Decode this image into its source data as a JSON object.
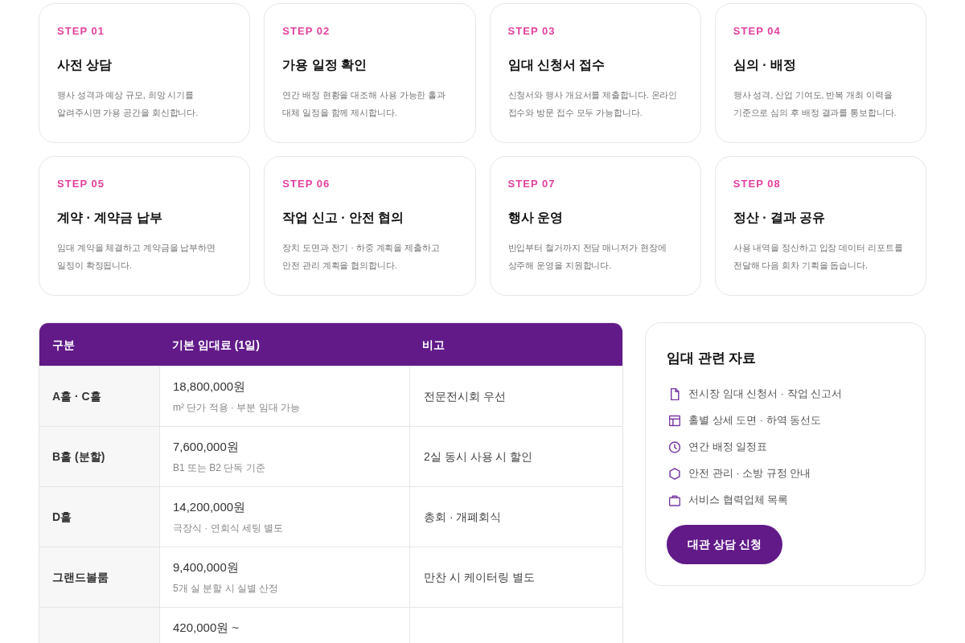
{
  "steps": [
    {
      "label": "STEP 01",
      "title": "사전 상담",
      "description": "행사 성격과 예상 규모, 희망 시기를\n알려주시면 가용 공간을 회신합니다."
    },
    {
      "label": "STEP 02",
      "title": "가용 일정 확인",
      "description": "연간 배정 현황을 대조해 사용 가능한 홀과\n대체 일정을 함께 제시합니다."
    },
    {
      "label": "STEP 03",
      "title": "임대 신청서 접수",
      "description": "신청서와 행사 개요서를 제출합니다. 온라인\n접수와 방문 접수 모두 가능합니다."
    },
    {
      "label": "STEP 04",
      "title": "심의 · 배정",
      "description": "행사 성격, 산업 기여도, 반복 개최 이력을\n기준으로 심의 후 배정 결과를 통보합니다."
    },
    {
      "label": "STEP 05",
      "title": "계약 · 계약금 납부",
      "description": "임대 계약을 체결하고 계약금을 납부하면\n일정이 확정됩니다."
    },
    {
      "label": "STEP 06",
      "title": "작업 신고 · 안전 협의",
      "description": "장치 도면과 전기 · 하중 계획을 제출하고\n안전 관리 계획을 협의합니다."
    },
    {
      "label": "STEP 07",
      "title": "행사 운영",
      "description": "반입부터 철거까지 전담 매니저가 현장에\n상주해 운영을 지원합니다."
    },
    {
      "label": "STEP 08",
      "title": "정산 · 결과 공유",
      "description": "사용 내역을 정산하고 입장 데이터 리포트를\n전달해 다음 회차 기획을 돕습니다."
    }
  ],
  "rate_table": {
    "columns": [
      "구분",
      "기본 임대료 (1일)",
      "비고"
    ],
    "rows": [
      {
        "hall": "A홀 · C홀",
        "price": "18,800,000원",
        "price_note": "m² 단가 적용 · 부분 임대 가능",
        "remark": "전문전시회 우선"
      },
      {
        "hall": "B홀 (분할)",
        "price": "7,600,000원",
        "price_note": "B1 또는 B2 단독 기준",
        "remark": "2실 동시 사용 시 할인"
      },
      {
        "hall": "D홀",
        "price": "14,200,000원",
        "price_note": "극장식 · 연회식 세팅 별도",
        "remark": "총회 · 개폐회식"
      },
      {
        "hall": "그랜드볼룸",
        "price": "9,400,000원",
        "price_note": "5개 실 분할 시 실별 산정",
        "remark": "만찬 시 케이터링 별도"
      },
      {
        "price": "420,000원 ~"
      }
    ]
  },
  "resources": {
    "title": "임대 관련 자료",
    "items": [
      {
        "label": "전시장 임대 신청서 · 작업 신고서"
      },
      {
        "label": "홀별 상세 도면 · 하역 동선도"
      },
      {
        "label": "연간 배정 일정표"
      },
      {
        "label": "안전 관리 · 소방 규정 안내"
      },
      {
        "label": "서비스 협력업체 목록"
      }
    ],
    "button": "대관 상담 신청"
  }
}
